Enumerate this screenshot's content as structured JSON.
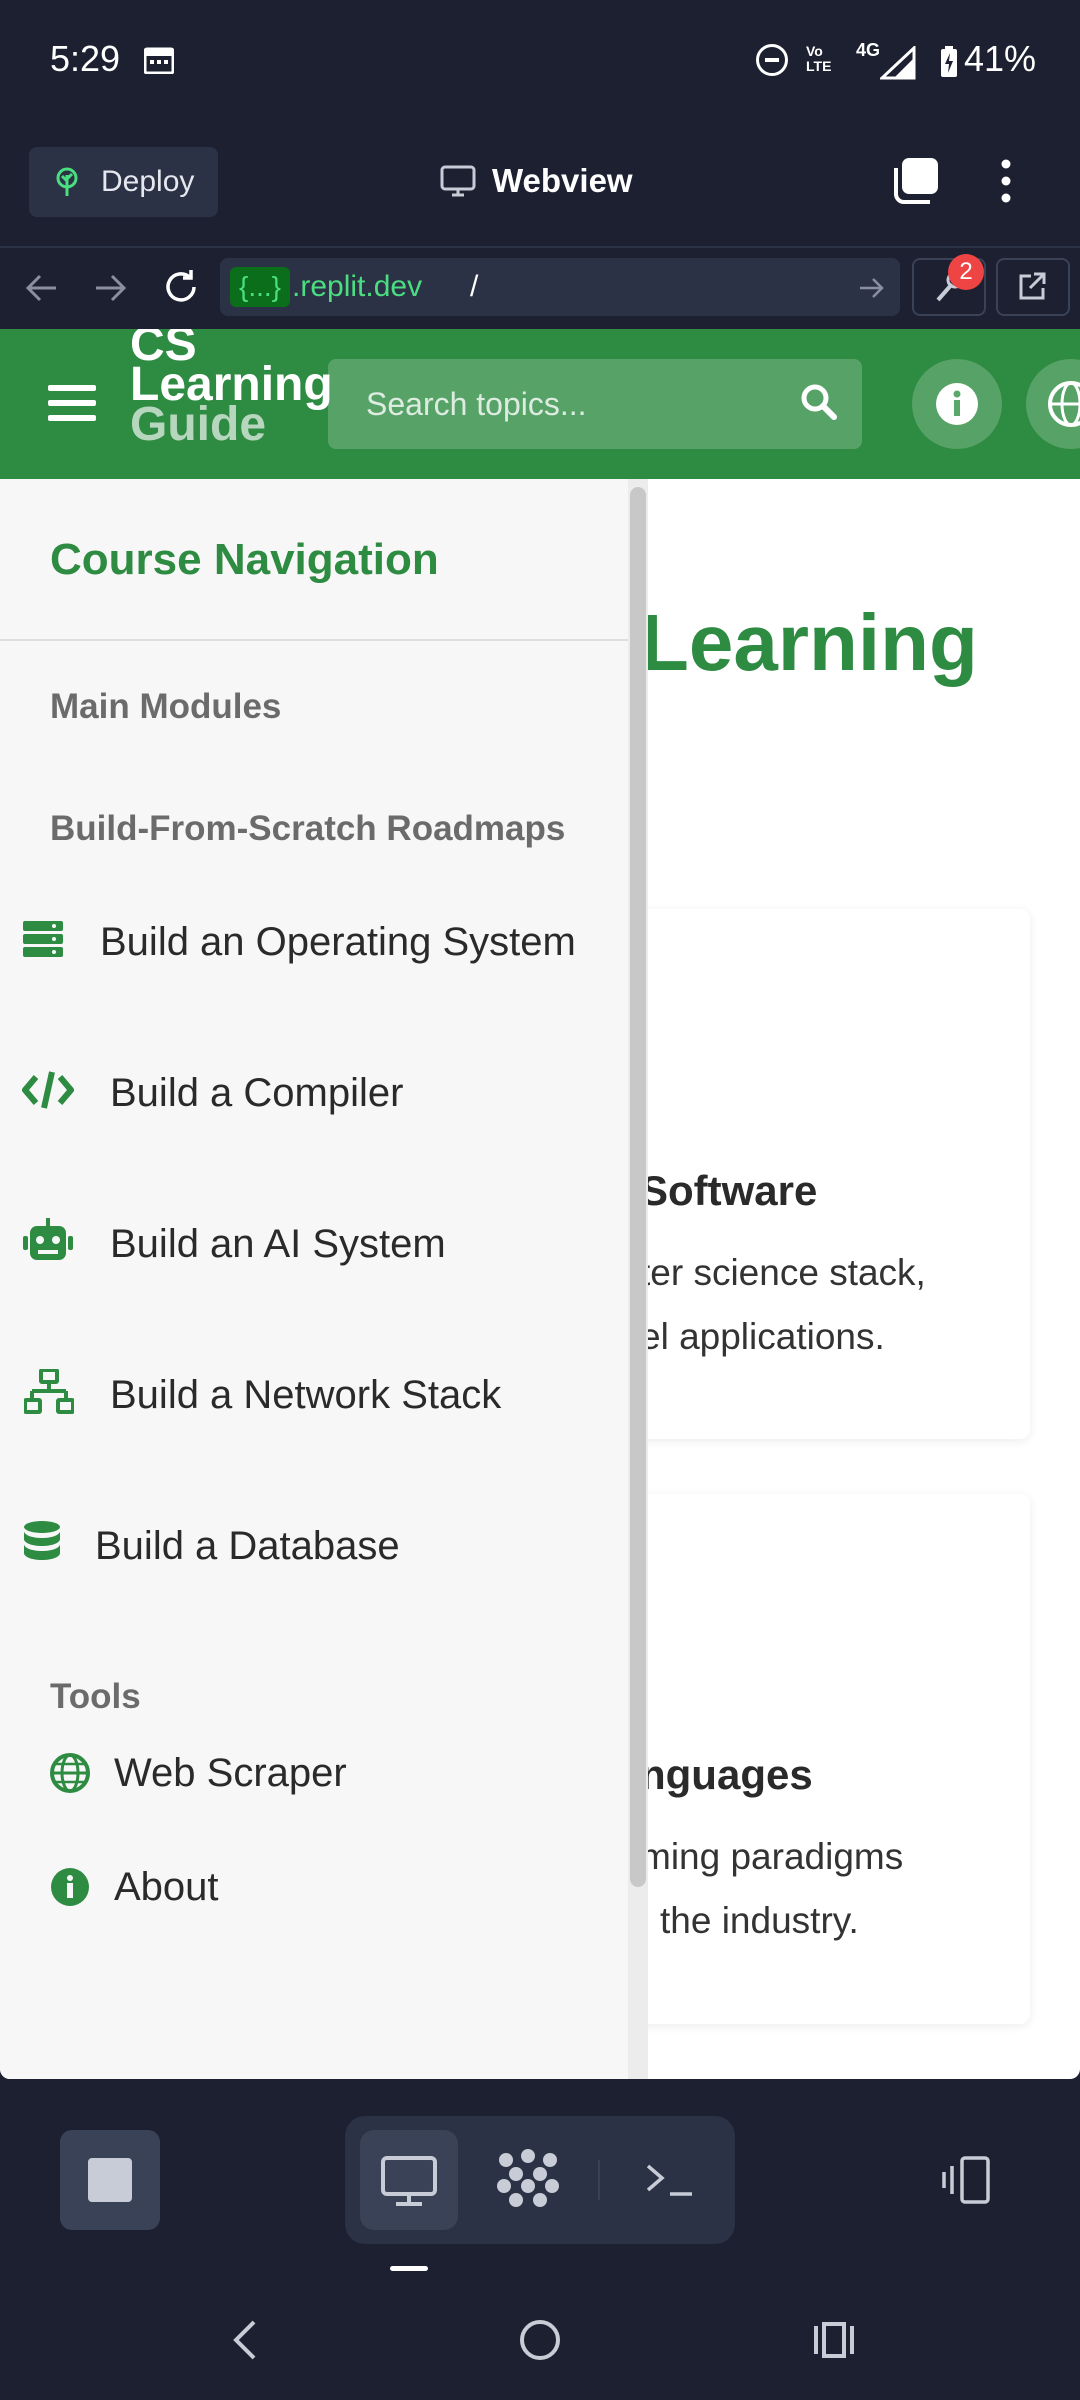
{
  "status_bar": {
    "time": "5:29",
    "volte": "Vo LTE",
    "network": "4G",
    "battery": "41%"
  },
  "toolbar": {
    "deploy_label": "Deploy",
    "title": "Webview"
  },
  "urlbar": {
    "badge": "{...}",
    "domain": ".replit.dev",
    "path": "/",
    "tools_badge": "2"
  },
  "site": {
    "title_top": "CS",
    "title_mid": "Learning",
    "title_bot": "Guide",
    "search_placeholder": "Search topics...",
    "accent": "#2e8b42"
  },
  "background": {
    "heading": "Learning",
    "card1_title": "Software",
    "card1_line1": "ter science stack,",
    "card1_line2": "el applications.",
    "card2_title": "nguages",
    "card2_line1": "ming paradigms",
    "card2_line2": "the industry."
  },
  "drawer": {
    "title": "Course Navigation",
    "main_modules": "Main Modules",
    "roadmaps_heading": "Build-From-Scratch Roadmaps",
    "roadmaps": [
      {
        "label": "Build an Operating System",
        "icon": "server-icon"
      },
      {
        "label": "Build a Compiler",
        "icon": "code-icon"
      },
      {
        "label": "Build an AI System",
        "icon": "robot-icon"
      },
      {
        "label": "Build a Network Stack",
        "icon": "network-icon"
      },
      {
        "label": "Build a Database",
        "icon": "database-icon"
      }
    ],
    "tools_heading": "Tools",
    "tools": [
      {
        "label": "Web Scraper",
        "icon": "globe-icon"
      },
      {
        "label": "About",
        "icon": "info-icon"
      }
    ]
  }
}
